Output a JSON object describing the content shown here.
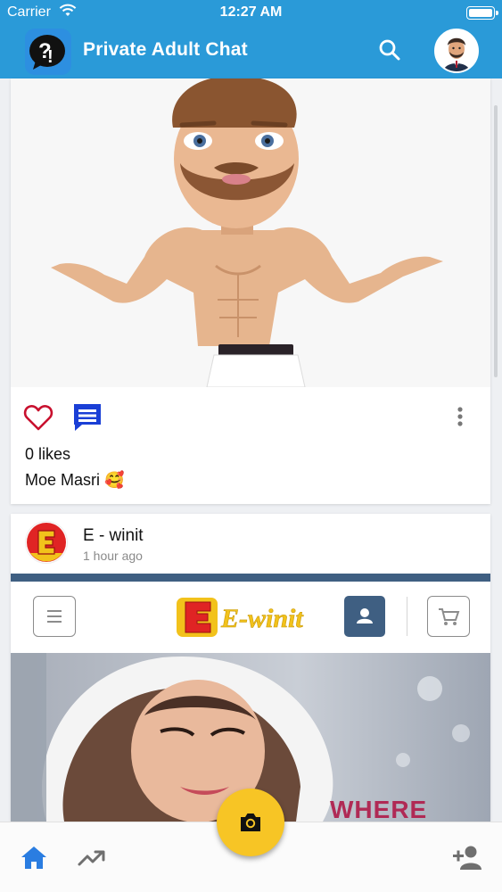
{
  "status_bar": {
    "carrier": "Carrier",
    "time": "12:27 AM"
  },
  "app_bar": {
    "title": "Private Adult Chat"
  },
  "posts": [
    {
      "likes": "0 likes",
      "caption": "Moe Masri 🥰"
    },
    {
      "author": "E - winit",
      "time": "1 hour ago",
      "image_text": {
        "logo": "E-winit",
        "hero_word": "WHERE"
      }
    }
  ],
  "icons": {
    "app_logo": "question-bubble-icon",
    "search": "search-icon",
    "like": "heart-outline-icon",
    "comment": "comment-icon",
    "more": "more-vertical-icon",
    "home": "home-icon",
    "trending": "trending-up-icon",
    "camera": "camera-icon",
    "add_friend": "person-add-icon"
  },
  "colors": {
    "app_bar": "#2a9ad8",
    "like": "#c8102e",
    "comment": "#1a3fd6",
    "nav_active": "#2a7de1",
    "nav_inactive": "#6f6f6f",
    "camera_button": "#f7c525"
  }
}
